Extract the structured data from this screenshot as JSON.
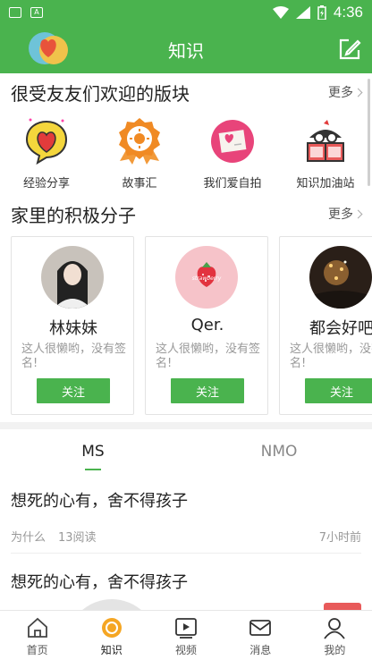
{
  "status_bar": {
    "time": "4:36"
  },
  "app_bar": {
    "title": "知识"
  },
  "popular_section": {
    "title": "很受友友们欢迎的版块",
    "more": "更多",
    "categories": [
      {
        "label": "经验分享",
        "icon": "heart-bubble-icon"
      },
      {
        "label": "故事汇",
        "icon": "sun-badge-icon"
      },
      {
        "label": "我们爱自拍",
        "icon": "photo-card-icon"
      },
      {
        "label": "知识加油站",
        "icon": "reading-book-icon"
      }
    ]
  },
  "members_section": {
    "title": "家里的积极分子",
    "more": "更多",
    "members": [
      {
        "name": "林妹妹",
        "signature": "这人很懒哟，没有签名!",
        "follow": "关注"
      },
      {
        "name": "Qer.",
        "signature": "这人很懒哟，没有签名!",
        "follow": "关注"
      },
      {
        "name": "都会好吧",
        "signature": "这人很懒哟，没有签名!",
        "follow": "关注"
      }
    ],
    "avatar_text": "strawberry"
  },
  "tabs": [
    {
      "label": "MS",
      "active": true
    },
    {
      "label": "NMO",
      "active": false
    }
  ],
  "articles": [
    {
      "title": "想死的心有，舍不得孩子",
      "category": "为什么",
      "views": "13阅读",
      "time": "7小时前"
    },
    {
      "title": "想死的心有，舍不得孩子"
    }
  ],
  "bottom_nav": [
    {
      "label": "首页",
      "icon": "home-icon"
    },
    {
      "label": "知识",
      "icon": "knowledge-icon",
      "active": true
    },
    {
      "label": "视频",
      "icon": "video-icon"
    },
    {
      "label": "消息",
      "icon": "message-icon"
    },
    {
      "label": "我的",
      "icon": "profile-icon"
    }
  ],
  "colors": {
    "brand_green": "#4ab34e",
    "active_orange": "#f5a623"
  }
}
